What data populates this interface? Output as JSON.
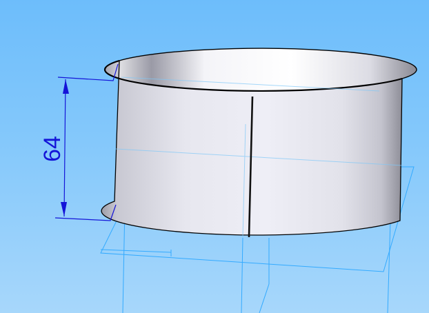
{
  "viewport": {
    "background_top": "#6dbdfb",
    "background_bottom": "#a7d7fb"
  },
  "dimension": {
    "value": "64",
    "color": "#1414d8"
  },
  "model": {
    "type": "thin-wall cylinder",
    "seam_color": "#111111",
    "edge_color": "#000000"
  },
  "reference_plane_color": "#33aaff"
}
